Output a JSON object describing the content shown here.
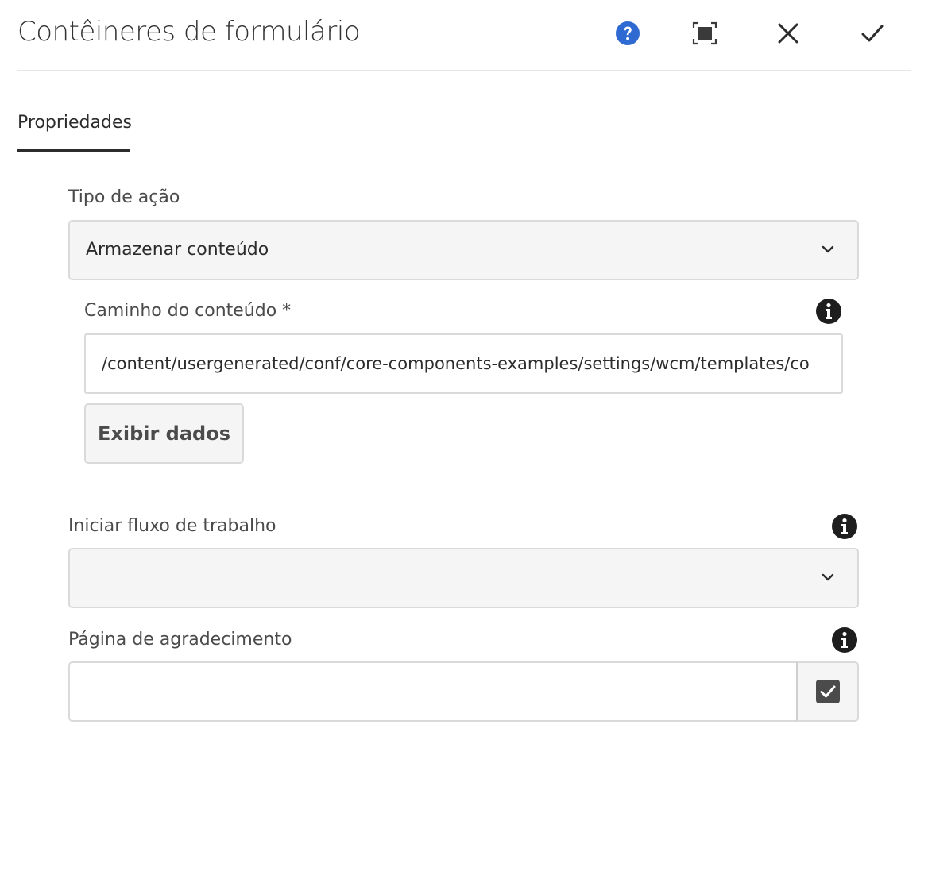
{
  "dialog": {
    "title": "Contêineres de formulário",
    "header_icons": [
      "help-icon",
      "fullscreen-icon",
      "close-icon",
      "check-icon"
    ],
    "colors": {
      "help_icon": "#2f6ad3",
      "text": "#2c2c2c",
      "field_background": "#f5f5f5",
      "border": "#dadada"
    }
  },
  "tabs": [
    {
      "label": "Propriedades",
      "selected": true
    }
  ],
  "form": {
    "action_type": {
      "label": "Tipo de ação",
      "value": "Armazenar conteúdo"
    },
    "content_path": {
      "label": "Caminho do conteúdo *",
      "value": "/content/usergenerated/conf/core-components-examples/settings/wcm/templates/co"
    },
    "view_data_button": {
      "label": "Exibir dados"
    },
    "workflow": {
      "label": "Iniciar fluxo de trabalho",
      "value": ""
    },
    "thank_you_page": {
      "label": "Página de agradecimento",
      "value": ""
    }
  }
}
